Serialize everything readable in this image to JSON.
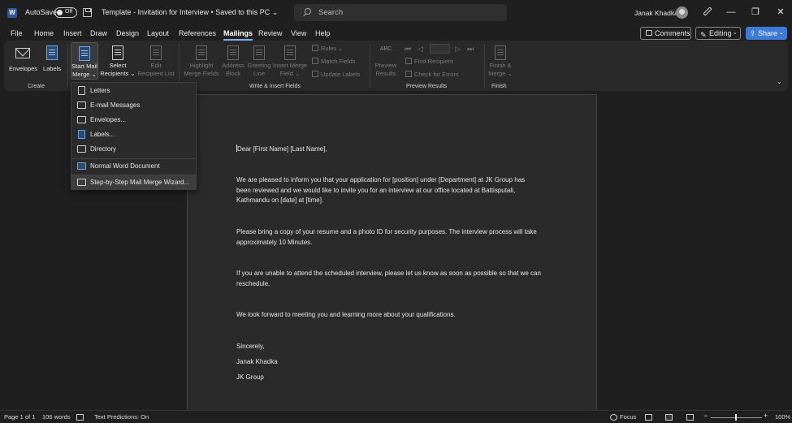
{
  "titlebar": {
    "autosave_label": "AutoSave",
    "autosave_state": "Off",
    "doc_title": "Template - Invitation for Interview  •  Saved to this PC ⌄",
    "search_placeholder": "Search",
    "user_name": "Janak Khadka",
    "minimize": "—",
    "restore": "❐",
    "close": "✕"
  },
  "menu": {
    "tabs": [
      "File",
      "Home",
      "Insert",
      "Draw",
      "Design",
      "Layout",
      "References",
      "Mailings",
      "Review",
      "View",
      "Help"
    ],
    "active_tab": "Mailings",
    "comments_label": "Comments",
    "editing_label": "Editing",
    "share_label": "Share"
  },
  "ribbon": {
    "create": {
      "group_label": "Create",
      "envelopes": "Envelopes",
      "labels": "Labels"
    },
    "start": {
      "start_mail_merge_1": "Start Mail",
      "start_mail_merge_2": "Merge ⌄",
      "select_recipients_1": "Select",
      "select_recipients_2": "Recipients ⌄",
      "edit_recipient_1": "Edit",
      "edit_recipient_2": "Recipient List"
    },
    "write_insert": {
      "group_label": "Write & Insert Fields",
      "highlight_1": "Highlight",
      "highlight_2": "Merge Fields",
      "address_1": "Address",
      "address_2": "Block",
      "greeting_1": "Greeting",
      "greeting_2": "Line",
      "insert_merge_1": "Insert Merge",
      "insert_merge_2": "Field ⌄",
      "rules": "Rules ⌄",
      "match_fields": "Match Fields",
      "update_labels": "Update Labels"
    },
    "preview": {
      "group_label": "Preview Results",
      "preview_abc": "ABC",
      "preview_1": "Preview",
      "preview_2": "Results",
      "find_recipient": "Find Recipient",
      "check_errors": "Check for Errors"
    },
    "finish": {
      "group_label": "Finish",
      "finish_1": "Finish &",
      "finish_2": "Merge ⌄"
    }
  },
  "dropdown": {
    "items": [
      "Letters",
      "E-mail Messages",
      "Envelopes...",
      "Labels...",
      "Directory",
      "Normal Word Document",
      "Step-by-Step Mail Merge Wizard..."
    ]
  },
  "document": {
    "greeting": "Dear [First Name] [Last Name],",
    "p1_l1": "We are pleased to inform you that your application for [position] under [Department] at JK Group has",
    "p1_l2": "been reviewed and we would like to invite you for an interview at our office located at Battisputali,",
    "p1_l3": "Kathmandu on [date] at [time].",
    "p2_l1": "Please bring a copy of your resume and a photo ID for security purposes. The interview process will take",
    "p2_l2": "approximately 10 Minutes.",
    "p3_l1": "If you are unable to attend the scheduled interview, please let us know as soon as possible so that we can",
    "p3_l2": "reschedule.",
    "p4": "We look forward to meeting you and learning more about your qualifications.",
    "closing": "Sincerely,",
    "signer": "Janak Khadka",
    "company": "JK Group"
  },
  "statusbar": {
    "page": "Page 1 of 1",
    "words": "106 words",
    "predictions": "Text Predictions: On",
    "focus": "Focus",
    "zoom": "100%",
    "zoom_minus": "−",
    "zoom_plus": "+"
  },
  "colors": {
    "accent": "#3d7ad6",
    "active_tab_underline": "#7cb0ff",
    "background": "#1f1f1f",
    "ribbon": "#292929",
    "page": "#2a2a2a"
  }
}
